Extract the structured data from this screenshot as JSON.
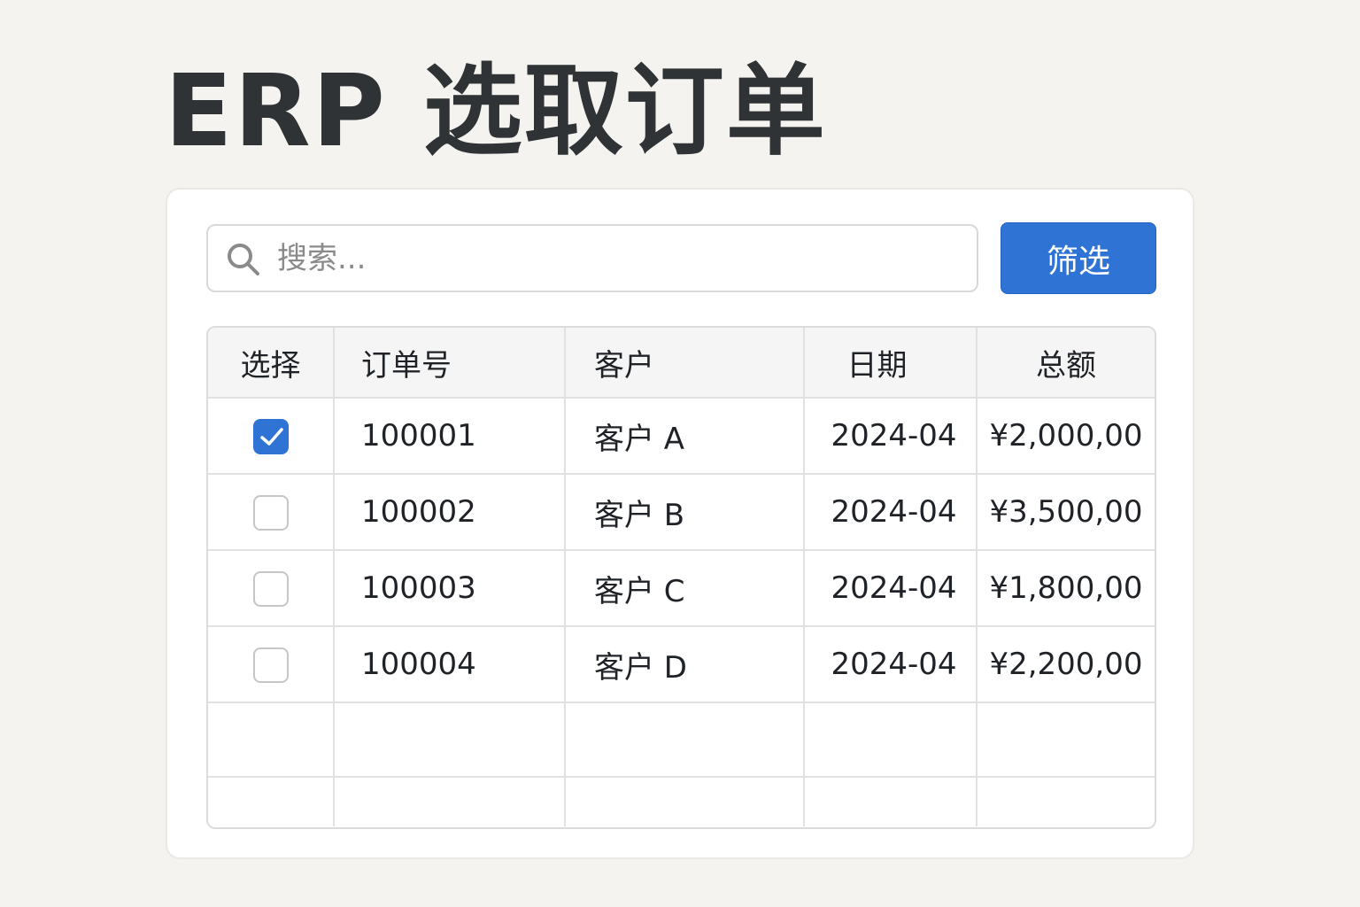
{
  "header": {
    "title": "ERP 选取订单"
  },
  "search": {
    "placeholder": "搜索...",
    "value": ""
  },
  "toolbar": {
    "filter_label": "筛选"
  },
  "table": {
    "columns": [
      "选择",
      "订单号",
      "客户",
      "日期",
      "总额"
    ],
    "rows": [
      {
        "selected": true,
        "order_no": "100001",
        "customer": "客户 A",
        "date": "2024-04",
        "total": "¥2,000,00"
      },
      {
        "selected": false,
        "order_no": "100002",
        "customer": "客户 B",
        "date": "2024-04",
        "total": "¥3,500,00"
      },
      {
        "selected": false,
        "order_no": "100003",
        "customer": "客户 C",
        "date": "2024-04",
        "total": "¥1,800,00"
      },
      {
        "selected": false,
        "order_no": "100004",
        "customer": "客户 D",
        "date": "2024-04",
        "total": "¥2,200,00"
      }
    ]
  },
  "colors": {
    "accent": "#2f74d4",
    "background": "#f4f3f0",
    "title": "#2f3336"
  },
  "icons": {
    "search": "search-icon",
    "check": "check-icon"
  }
}
